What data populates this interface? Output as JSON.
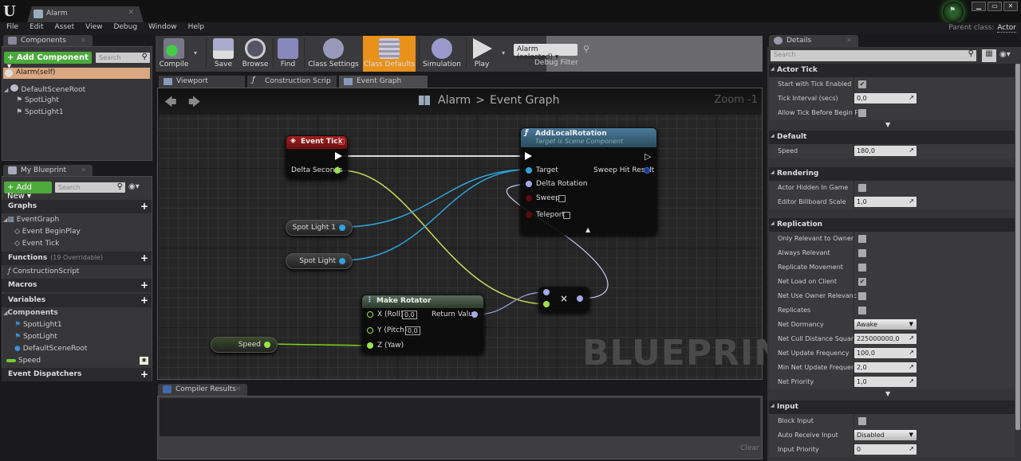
{
  "window": {
    "tab_title": "Alarm",
    "parent_class_label": "Parent class:",
    "parent_class_value": "Actor",
    "controls": [
      "minimize",
      "maximize",
      "close"
    ]
  },
  "menu": [
    "File",
    "Edit",
    "Asset",
    "View",
    "Debug",
    "Window",
    "Help"
  ],
  "components_panel": {
    "tab_label": "Components",
    "add_button": "+ Add Component ▾",
    "search_placeholder": "Search",
    "self_item": "Alarm(self)",
    "tree": [
      "DefaultSceneRoot",
      "SpotLight",
      "SpotLight1"
    ]
  },
  "my_blueprint_panel": {
    "tab_label": "My Blueprint",
    "add_button": "+ Add New ▾",
    "search_placeholder": "Search",
    "graphs_label": "Graphs",
    "event_graph": "EventGraph",
    "events": [
      "Event BeginPlay",
      "Event Tick"
    ],
    "functions_label": "Functions",
    "functions_sub": "(19 Overridable)",
    "functions": [
      "ConstructionScript"
    ],
    "macros_label": "Macros",
    "variables_label": "Variables",
    "components_label": "Components",
    "component_vars": [
      "SpotLight1",
      "SpotLight",
      "DefaultSceneRoot"
    ],
    "variable": "Speed",
    "dispatchers_label": "Event Dispatchers"
  },
  "toolbar": {
    "buttons": [
      "Compile",
      "Save",
      "Browse",
      "Find",
      "Class Settings",
      "Class Defaults",
      "Simulation",
      "Play"
    ],
    "active": "Class Defaults",
    "debug_selected": "Alarm (selected) ▾",
    "debug_label": "Debug Filter",
    "accent": "#e8921c"
  },
  "graph_tabs": [
    "Viewport",
    "Construction Scrip",
    "Event Graph"
  ],
  "graph": {
    "breadcrumb_root": "Alarm",
    "breadcrumb_sep": ">",
    "breadcrumb_leaf": "Event Graph",
    "zoom": "Zoom -1",
    "watermark": "BLUEPRINT",
    "nodes": {
      "event_tick": {
        "title": "Event Tick",
        "output": "Delta Seconds"
      },
      "add_local_rotation": {
        "title": "AddLocalRotation",
        "subtitle": "Target is Scene Component",
        "inputs": [
          "Target",
          "Delta Rotation",
          "Sweep",
          "Teleport"
        ],
        "output": "Sweep Hit Result"
      },
      "spot_light_1": "Spot Light 1",
      "spot_light": "Spot Light",
      "speed": "Speed",
      "make_rotator": {
        "title": "Make Rotator",
        "inputs": [
          "X (Roll)",
          "Y (Pitch)",
          "Z (Yaw)"
        ],
        "x_value": "0,0",
        "y_value": "0,0",
        "output": "Return Value"
      },
      "multiply": "×"
    }
  },
  "compiler": {
    "tab_label": "Compiler Results",
    "clear": "Clear"
  },
  "details": {
    "tab_label": "Details",
    "search_placeholder": "Search",
    "sections": [
      {
        "title": "Actor Tick",
        "rows": [
          {
            "label": "Start with Tick Enabled",
            "type": "check",
            "value": true
          },
          {
            "label": "Tick Interval (secs)",
            "type": "num",
            "value": "0,0"
          },
          {
            "label": "Allow Tick Before Begin P",
            "type": "check",
            "value": false
          }
        ]
      },
      {
        "title": "Default",
        "rows": [
          {
            "label": "Speed",
            "type": "num",
            "value": "180,0"
          }
        ]
      },
      {
        "title": "Rendering",
        "rows": [
          {
            "label": "Actor Hidden In Game",
            "type": "check",
            "value": false
          },
          {
            "label": "Editor Billboard Scale",
            "type": "num",
            "value": "1,0"
          }
        ]
      },
      {
        "title": "Replication",
        "rows": [
          {
            "label": "Only Relevant to Owner",
            "type": "check",
            "value": false
          },
          {
            "label": "Always Relevant",
            "type": "check",
            "value": false
          },
          {
            "label": "Replicate Movement",
            "type": "check",
            "value": false
          },
          {
            "label": "Net Load on Client",
            "type": "check",
            "value": true
          },
          {
            "label": "Net Use Owner Relevanc",
            "type": "check",
            "value": false
          },
          {
            "label": "Replicates",
            "type": "check",
            "value": false
          },
          {
            "label": "Net Dormancy",
            "type": "select",
            "value": "Awake"
          },
          {
            "label": "Net Cull Distance Square",
            "type": "num",
            "value": "225000000,0"
          },
          {
            "label": "Net Update Frequency",
            "type": "num",
            "value": "100,0"
          },
          {
            "label": "Min Net Update Frequenc",
            "type": "num",
            "value": "2,0"
          },
          {
            "label": "Net Priority",
            "type": "num",
            "value": "1,0"
          }
        ]
      },
      {
        "title": "Input",
        "rows": [
          {
            "label": "Block Input",
            "type": "check",
            "value": false
          },
          {
            "label": "Auto Receive Input",
            "type": "select",
            "value": "Disabled"
          },
          {
            "label": "Input Priority",
            "type": "num",
            "value": "0"
          }
        ]
      }
    ]
  }
}
